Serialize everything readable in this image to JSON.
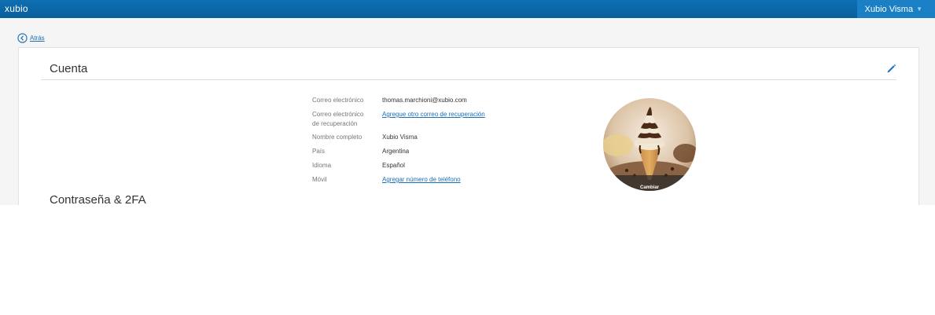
{
  "header": {
    "brand": "xubio",
    "user_name": "Xubio Visma"
  },
  "nav": {
    "back_label": "Atrás"
  },
  "account": {
    "title": "Cuenta",
    "fields": [
      {
        "label": "Correo electrónico",
        "value": "thomas.marchioni@xubio.com"
      },
      {
        "label_line1": "Correo electrónico",
        "label_line2": "de recuperación",
        "link": "Agregue otro correo de recuperación"
      },
      {
        "label": "Nombre completo",
        "value": "Xubio Visma"
      },
      {
        "label": "País",
        "value": "Argentina"
      },
      {
        "label": "Idioma",
        "value": "Español"
      },
      {
        "label": "Móvil",
        "link": "Agregar número de teléfono"
      }
    ],
    "avatar_change_label": "Cambiar"
  },
  "security": {
    "title": "Contraseña & 2FA"
  },
  "colors": {
    "topbar": "#0a5f9c",
    "link": "#1a6fb5",
    "edit_icon": "#1a73c4"
  }
}
